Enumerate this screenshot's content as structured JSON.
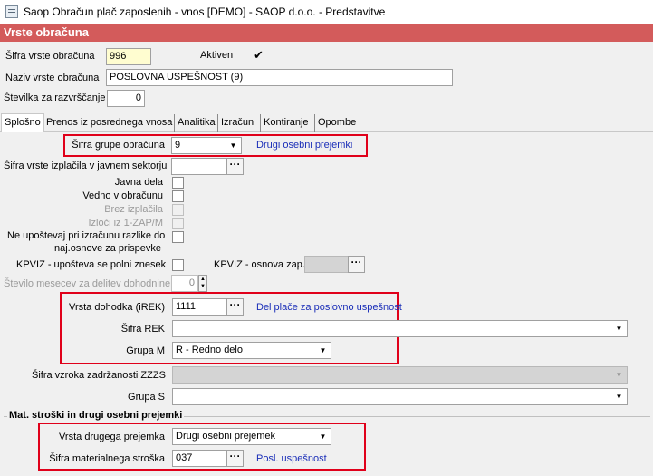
{
  "window": {
    "title": "Saop Obračun plač zaposlenih - vnos [DEMO] - SAOP d.o.o. - Predstavitve"
  },
  "header": {
    "title": "Vrste obračuna"
  },
  "top": {
    "sifra_label": "Šifra vrste obračuna",
    "sifra_value": "996",
    "aktiven_label": "Aktiven",
    "aktiven_checked": "✔",
    "naziv_label": "Naziv vrste obračuna",
    "naziv_value": "POSLOVNA USPEŠNOST (9)",
    "stevilka_label": "Številka  za razvrščanje",
    "stevilka_value": "0"
  },
  "tabs": [
    {
      "label": "Splošno"
    },
    {
      "label": "Prenos iz posrednega vnosa"
    },
    {
      "label": "Analitika"
    },
    {
      "label": "Izračun"
    },
    {
      "label": "Kontiranje"
    },
    {
      "label": "Opombe"
    }
  ],
  "general": {
    "sifra_grupe_label": "Šifra grupe obračuna",
    "sifra_grupe_value": "9",
    "sifra_grupe_desc": "Drugi osebni prejemki",
    "sifra_izplacila_label": "Šifra vrste izplačila v javnem sektorju",
    "sifra_izplacila_value": "",
    "javna_dela_label": "Javna dela",
    "vedno_label": "Vedno v obračunu",
    "brez_izplacila_label": "Brez izplačila",
    "izloci_label": "Izloči iz 1-ZAP/M",
    "ne_upostevaj_label_1": "Ne upoštevaj pri izračunu razlike do",
    "ne_upostevaj_label_2": "naj.osnove za prispevke",
    "kpviz_polni_label": "KPVIZ - upošteva se polni znesek",
    "kpviz_osnova_label": "KPVIZ - osnova zap.",
    "kpviz_osnova_value": "",
    "stevilo_mesecev_label": "Število mesecev za delitev dohodnine:",
    "stevilo_mesecev_value": "0",
    "vrsta_dohodka_label": "Vrsta dohodka (iREK)",
    "vrsta_dohodka_value": "1111",
    "vrsta_dohodka_desc": "Del plače za poslovno uspešnost",
    "sifra_rek_label": "Šifra REK",
    "sifra_rek_value": "",
    "grupa_m_label": "Grupa M",
    "grupa_m_value": "R - Redno delo",
    "sifra_vzroka_label": "Šifra vzroka zadržanosti ZZZS",
    "sifra_vzroka_value": "",
    "grupa_s_label": "Grupa S",
    "grupa_s_value": ""
  },
  "mat": {
    "section_title": "Mat. stroški in drugi osebni prejemki",
    "vrsta_prejemka_label": "Vrsta drugega prejemka",
    "vrsta_prejemka_value": "Drugi osebni prejemek",
    "sifra_stroska_label": "Šifra materialnega stroška",
    "sifra_stroska_value": "037",
    "sifra_stroska_desc": "Posl. uspešnost"
  },
  "icons": {
    "ellipsis": "···",
    "dropdown": "▼",
    "spin_up": "▲",
    "spin_down": "▼"
  },
  "colors": {
    "header_bg": "#d35b5b",
    "highlight_border": "#e0001a",
    "link": "#1a2eb8",
    "code_field_bg": "#fffdd0"
  }
}
